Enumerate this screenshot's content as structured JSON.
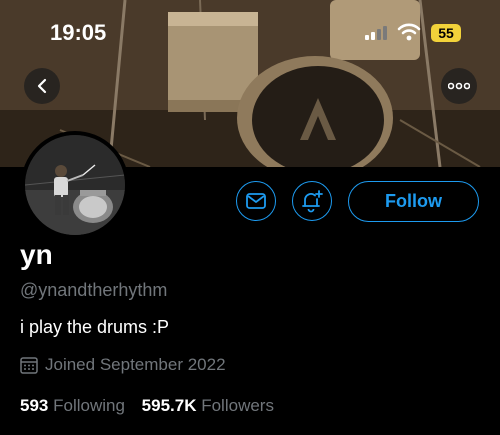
{
  "status_bar": {
    "time": "19:05",
    "battery": "55",
    "battery_color": "#f2d23a"
  },
  "profile": {
    "display_name": "yn",
    "handle": "@ynandtherhythm",
    "bio": "i play the drums :P",
    "joined": "Joined September 2022",
    "following_count": "593",
    "following_label": "Following",
    "followers_count": "595.7K",
    "followers_label": "Followers"
  },
  "actions": {
    "follow_label": "Follow"
  },
  "colors": {
    "accent": "#1d9bf0",
    "muted_text": "#71767b",
    "background": "#000000"
  },
  "icons": [
    "chevron-left-icon",
    "more-icon",
    "mail-icon",
    "bell-plus-icon",
    "calendar-icon",
    "signal-icon",
    "wifi-icon"
  ]
}
